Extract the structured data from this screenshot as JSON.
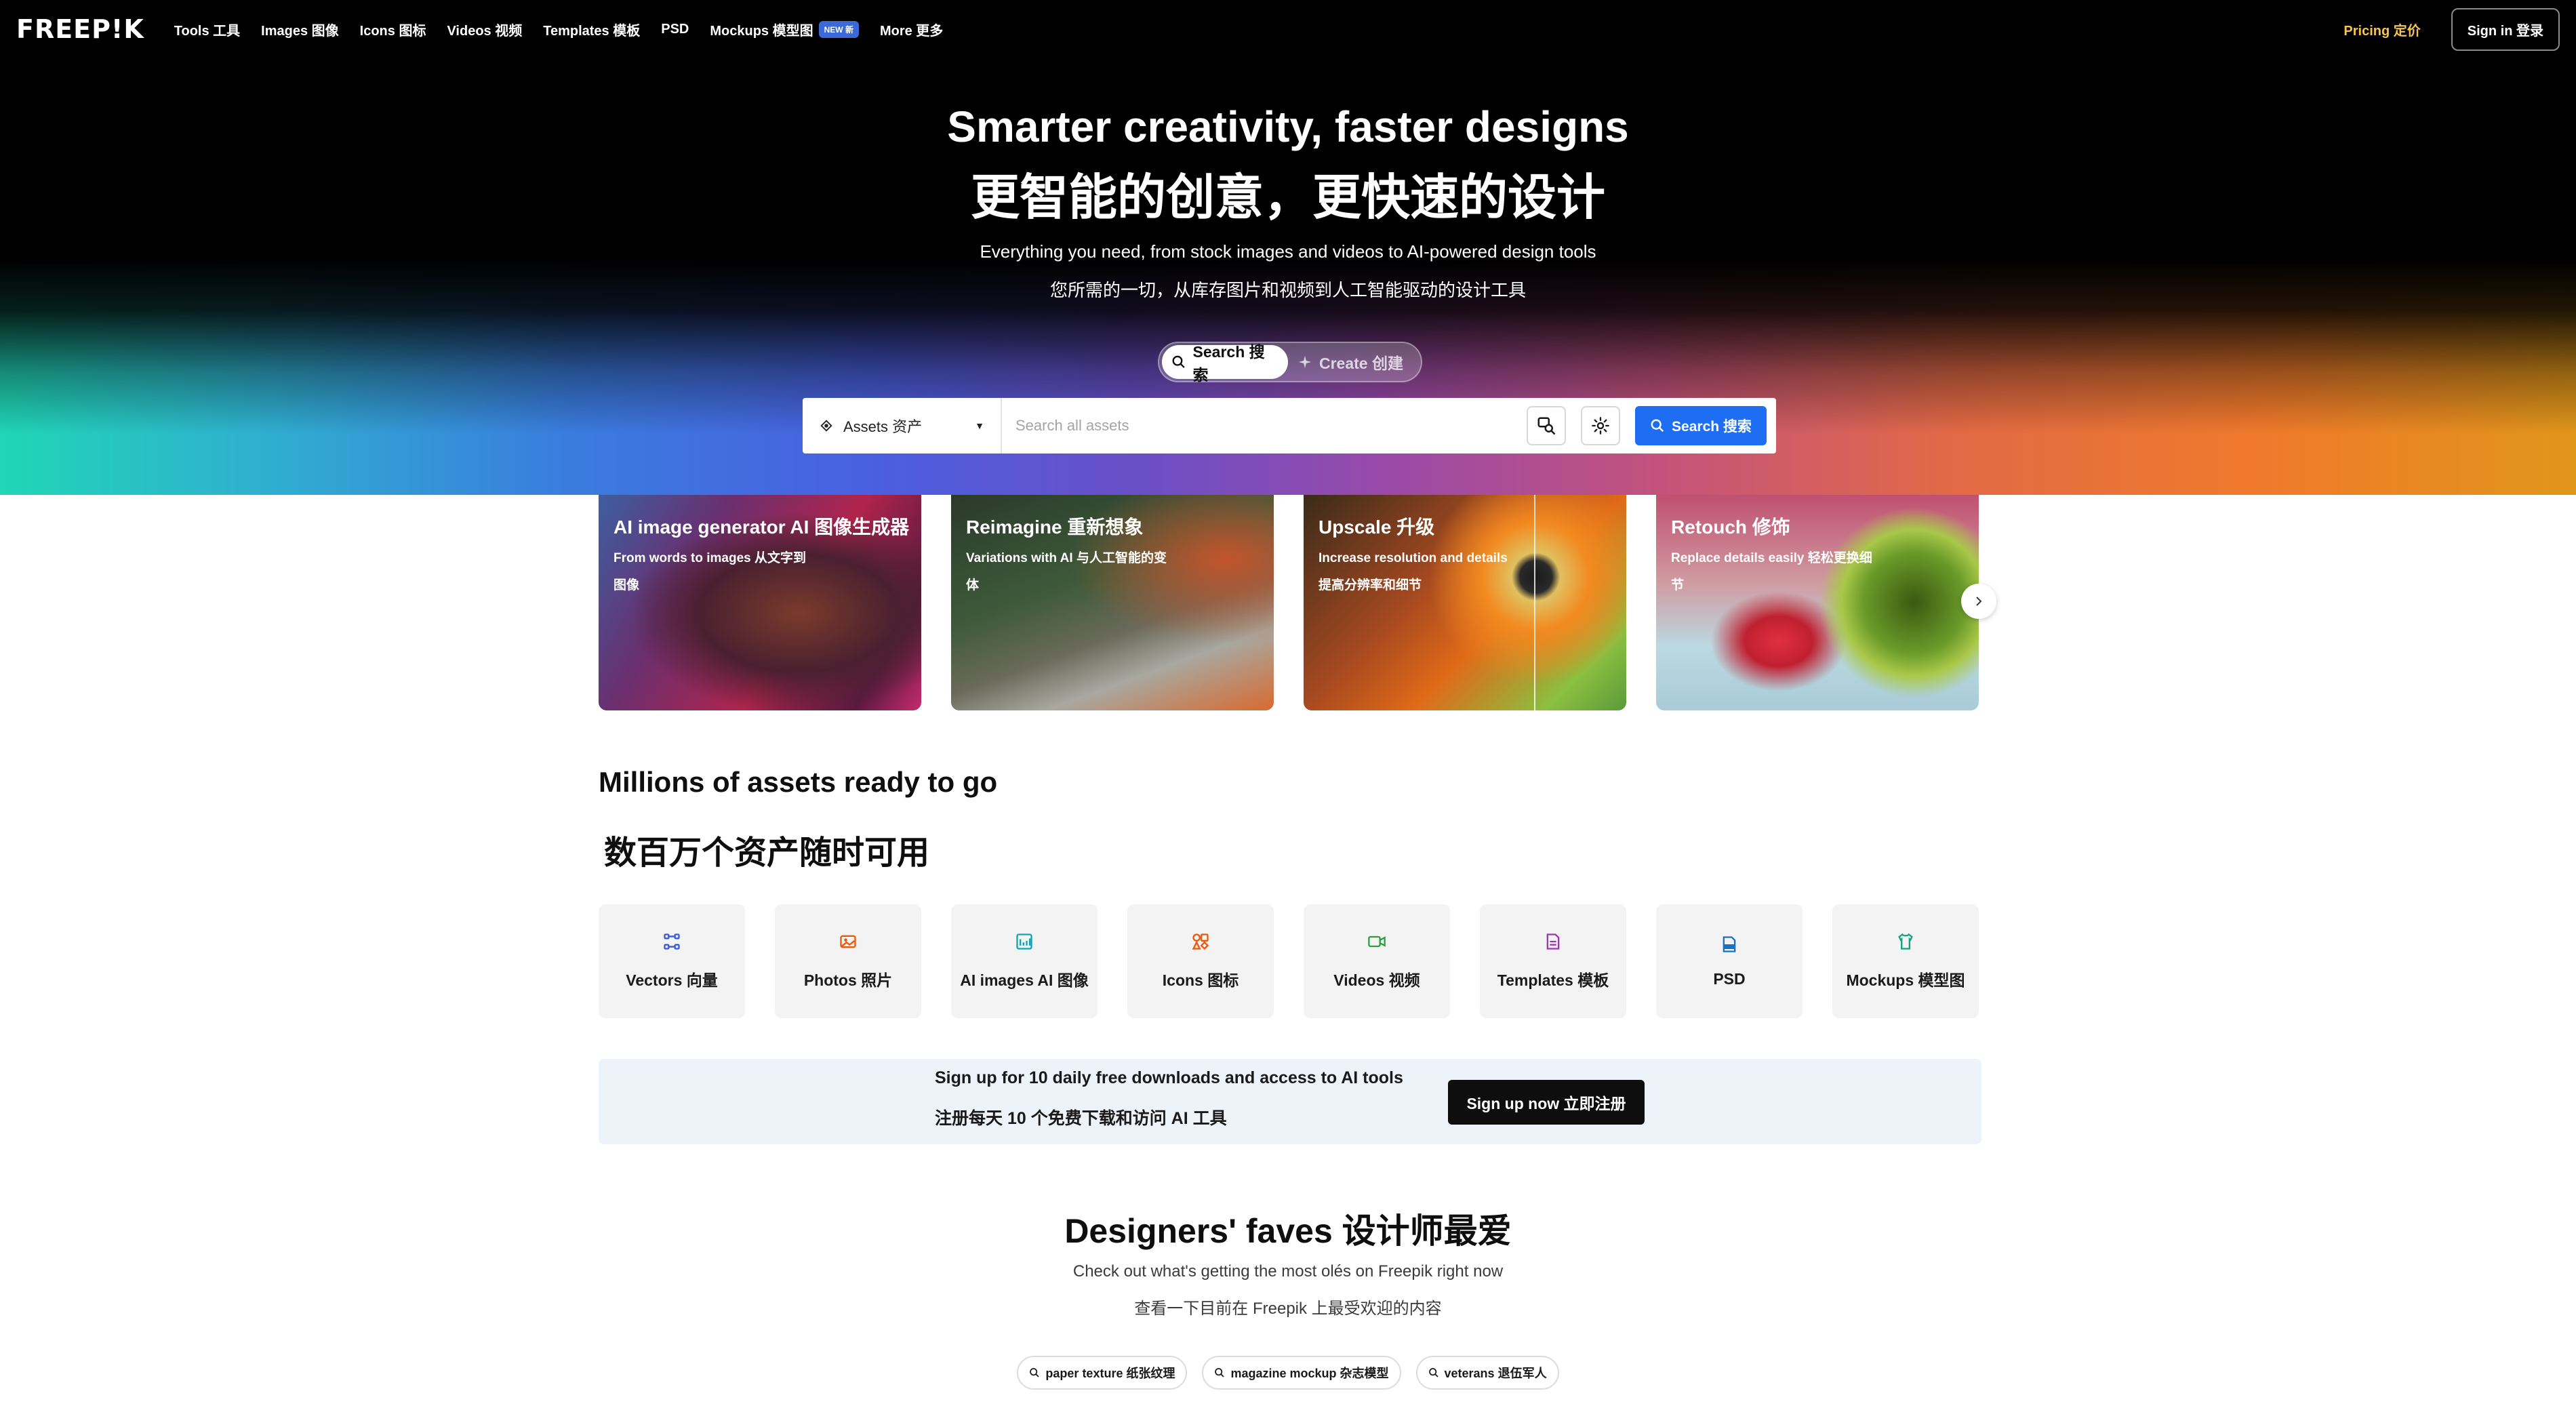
{
  "nav": {
    "logo": "FREEP!K",
    "items": [
      {
        "label": "Tools 工具"
      },
      {
        "label": "Images 图像"
      },
      {
        "label": "Icons 图标"
      },
      {
        "label": "Videos 视频"
      },
      {
        "label": "Templates 模板"
      },
      {
        "label": "PSD"
      },
      {
        "label": "Mockups 模型图",
        "badge": "NEW 新"
      },
      {
        "label": "More 更多"
      }
    ],
    "pricing": "Pricing 定价",
    "signin": "Sign in 登录"
  },
  "hero": {
    "title": "Smarter creativity, faster designs",
    "title_cn": "更智能的创意，更快速的设计",
    "subtitle": "Everything you need, from stock images and videos to AI-powered design tools",
    "subtitle_cn": "您所需的一切，从库存图片和视频到人工智能驱动的设计工具"
  },
  "mode_toggle": {
    "search": "Search 搜索",
    "create": "Create 创建",
    "active": "search"
  },
  "search": {
    "asset_select": "Assets 资产",
    "placeholder": "Search all assets",
    "value": "",
    "button": "Search 搜索"
  },
  "tool_cards": [
    {
      "title": "AI image generator AI 图像生成器",
      "subtitle": "From words to images 从文字到图像"
    },
    {
      "title": "Reimagine 重新想象",
      "subtitle": "Variations with AI 与人工智能的变体"
    },
    {
      "title": "Upscale 升级",
      "subtitle": "Increase resolution and details 提高分辨率和细节"
    },
    {
      "title": "Retouch 修饰",
      "subtitle": "Replace details easily 轻松更换细节"
    }
  ],
  "assets_section": {
    "title": "Millions of assets ready to go",
    "title_cn": "数百万个资产随时可用",
    "categories": [
      {
        "label": "Vectors 向量",
        "icon": "vector-icon",
        "color": "#3b5bdb"
      },
      {
        "label": "Photos 照片",
        "icon": "photo-icon",
        "color": "#e8590c"
      },
      {
        "label": "AI images AI 图像",
        "icon": "ai-image-icon",
        "color": "#12a4b5"
      },
      {
        "label": "Icons 图标",
        "icon": "icons-icon",
        "color": "#e8590c"
      },
      {
        "label": "Videos 视频",
        "icon": "video-icon",
        "color": "#2f9e44"
      },
      {
        "label": "Templates 模板",
        "icon": "template-icon",
        "color": "#9c36b5"
      },
      {
        "label": "PSD",
        "icon": "psd-icon",
        "color": "#1971c2"
      },
      {
        "label": "Mockups 模型图",
        "icon": "mockup-icon",
        "color": "#0ca678"
      }
    ]
  },
  "signup_banner": {
    "text": "Sign up for 10 daily free downloads and access to AI tools",
    "text_cn": "注册每天 10 个免费下载和访问 AI 工具",
    "button": "Sign up now 立即注册"
  },
  "faves": {
    "title": "Designers' faves 设计师最爱",
    "subtitle": "Check out what's getting the most olés on Freepik right now",
    "subtitle_cn": "查看一下目前在 Freepik 上最受欢迎的内容",
    "chips": [
      {
        "label": "paper texture 纸张纹理"
      },
      {
        "label": "magazine mockup 杂志模型"
      },
      {
        "label": "veterans 退伍军人"
      }
    ]
  },
  "colors": {
    "accent": "#1e6ef4",
    "pricing": "#f8c34a",
    "banner_bg": "#eef3fa"
  }
}
